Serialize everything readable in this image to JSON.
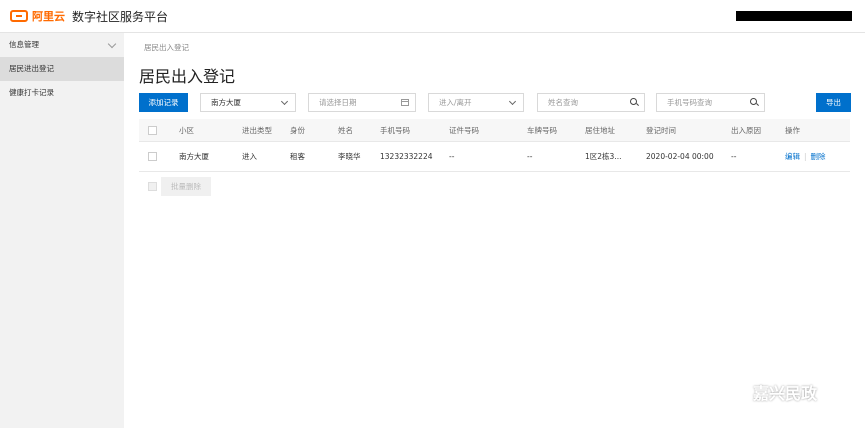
{
  "header": {
    "logo_text": "阿里云",
    "app_title": "数字社区服务平台"
  },
  "sidebar": {
    "items": [
      {
        "label": "信息管理"
      },
      {
        "label": "居民进出登记"
      },
      {
        "label": "健康打卡记录"
      }
    ]
  },
  "main": {
    "breadcrumb": "居民出入登记",
    "title": "居民出入登记",
    "toolbar": {
      "add_label": "添加记录",
      "community_select": "南方大厦",
      "date_placeholder": "请选择日期",
      "direction_placeholder": "进入/离开",
      "name_placeholder": "姓名查询",
      "phone_placeholder": "手机号码查询",
      "export_label": "导出"
    },
    "table": {
      "columns": [
        "小区",
        "进出类型",
        "身份",
        "姓名",
        "手机号码",
        "证件号码",
        "车牌号码",
        "居住地址",
        "登记时间",
        "出入原因",
        "操作"
      ],
      "rows": [
        {
          "community": "南方大厦",
          "type": "进入",
          "identity": "租客",
          "name": "李晓华",
          "phone": "13232332224",
          "id_number": "--",
          "plate": "--",
          "address": "1区2栋3...",
          "time": "2020-02-04 00:00",
          "reason": "--",
          "edit": "编辑",
          "delete": "删除"
        }
      ]
    },
    "bulk_delete_label": "批量删除"
  },
  "watermark": "嘉兴民政",
  "colors": {
    "brand": "#ff6a00",
    "primary": "#0070cc"
  }
}
